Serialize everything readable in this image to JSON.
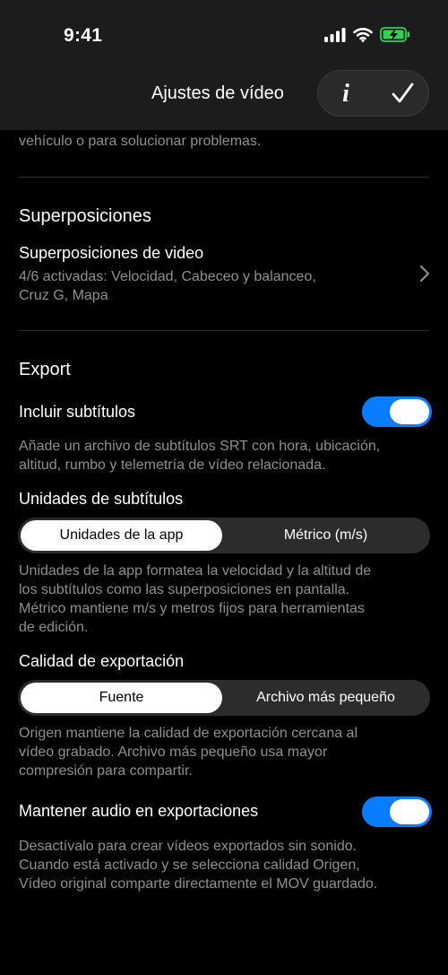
{
  "status_bar": {
    "time": "9:41"
  },
  "nav": {
    "title": "Ajustes de vídeo",
    "info_label": "i"
  },
  "intro_partial": "vehículo o para solucionar problemas.",
  "overlays": {
    "section_title": "Superposiciones",
    "row_title": "Superposiciones de video",
    "row_detail_line1": "4/6 activadas: Velocidad, Cabeceo y balanceo,",
    "row_detail_line2": "Cruz G, Mapa"
  },
  "export": {
    "section_title": "Export",
    "include_subtitles": {
      "label": "Incluir subtítulos",
      "on": true,
      "desc_line1": "Añade un archivo de subtítulos SRT con hora, ubicación,",
      "desc_line2": "altitud, rumbo y telemetría de vídeo relacionada."
    },
    "subtitle_units": {
      "label": "Unidades de subtítulos",
      "options": [
        "Unidades de la app",
        "Métrico (m/s)"
      ],
      "selected": "Unidades de la app",
      "desc_line1": "Unidades de la app formatea la velocidad y la altitud de",
      "desc_line2": "los subtítulos como las superposiciones en pantalla.",
      "desc_line3": "Métrico mantiene m/s y metros fijos para herramientas",
      "desc_line4": "de edición."
    },
    "export_quality": {
      "label": "Calidad de exportación",
      "options": [
        "Fuente",
        "Archivo más pequeño"
      ],
      "selected": "Fuente",
      "desc_line1": "Origen mantiene la calidad de exportación cercana al",
      "desc_line2": "vídeo grabado. Archivo más pequeño usa mayor",
      "desc_line3": "compresión para compartir."
    },
    "keep_audio": {
      "label": "Mantener audio en exportaciones",
      "on": true,
      "desc_line1": "Desactívalo para crear vídeos exportados sin sonido.",
      "desc_line2": "Cuando está activado y se selecciona calidad Origen,",
      "desc_line3": "Vídeo original comparte directamente el MOV guardado."
    }
  },
  "colors": {
    "background": "#000000",
    "toggle_on": "#0a7cff",
    "secondary_text": "#8e8e93",
    "battery": "#30d158"
  },
  "icons": [
    "signal-icon",
    "wifi-icon",
    "battery-charging-icon",
    "info-icon",
    "checkmark-icon",
    "chevron-right-icon"
  ]
}
